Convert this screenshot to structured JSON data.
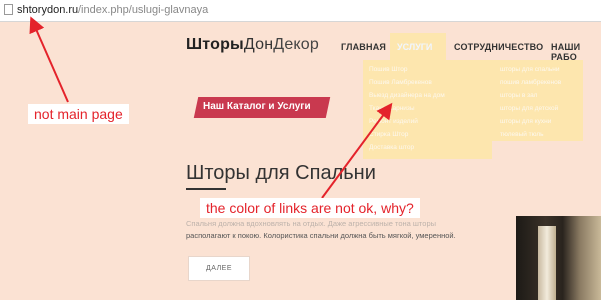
{
  "browser": {
    "url_host": "shtorydon.ru",
    "url_path": "/index.php/uslugi-glavnaya"
  },
  "site": {
    "logo_bold": "Шторы",
    "logo_regular": "Дон",
    "logo_light": "Декор"
  },
  "nav": {
    "home": "ГЛАВНАЯ",
    "services": "УСЛУГИ",
    "cooperation": "СОТРУДНИЧЕСТВО",
    "works": "НАШИ РАБО"
  },
  "dropdown": {
    "col1": [
      "Пошив Штор",
      "Пошив Ламбрекенов",
      "Выезд дизайнера на дом",
      "Ткани-Карнизы",
      "Ремонт изделий",
      "Стирка Штор",
      "Доставка штор"
    ],
    "col2": [
      "шторы для спальни",
      "пошив ламбрекенов",
      "шторы в зал",
      "шторы для детской",
      "шторы для кухни",
      "тюлевый тюль"
    ]
  },
  "main": {
    "catalog_badge": "Наш Каталог и Услуги",
    "section_title": "Шторы для Спальни",
    "desc_line1": "Спальня должна вдохновлять на отдых. Даже агрессивные тона шторы",
    "desc_line2": "располагают к покою. Колористика спальни должна быть мягкой, умеренной.",
    "more_button": "ДАЛЕЕ"
  },
  "annotations": {
    "note_main": "not main page",
    "note_links": "the color of links are not ok, why?",
    "color": "#e4232b"
  },
  "colors": {
    "page_bg": "#fbe2d3",
    "dropdown_bg": "#fde6ae",
    "badge_bg": "#c9394f"
  }
}
